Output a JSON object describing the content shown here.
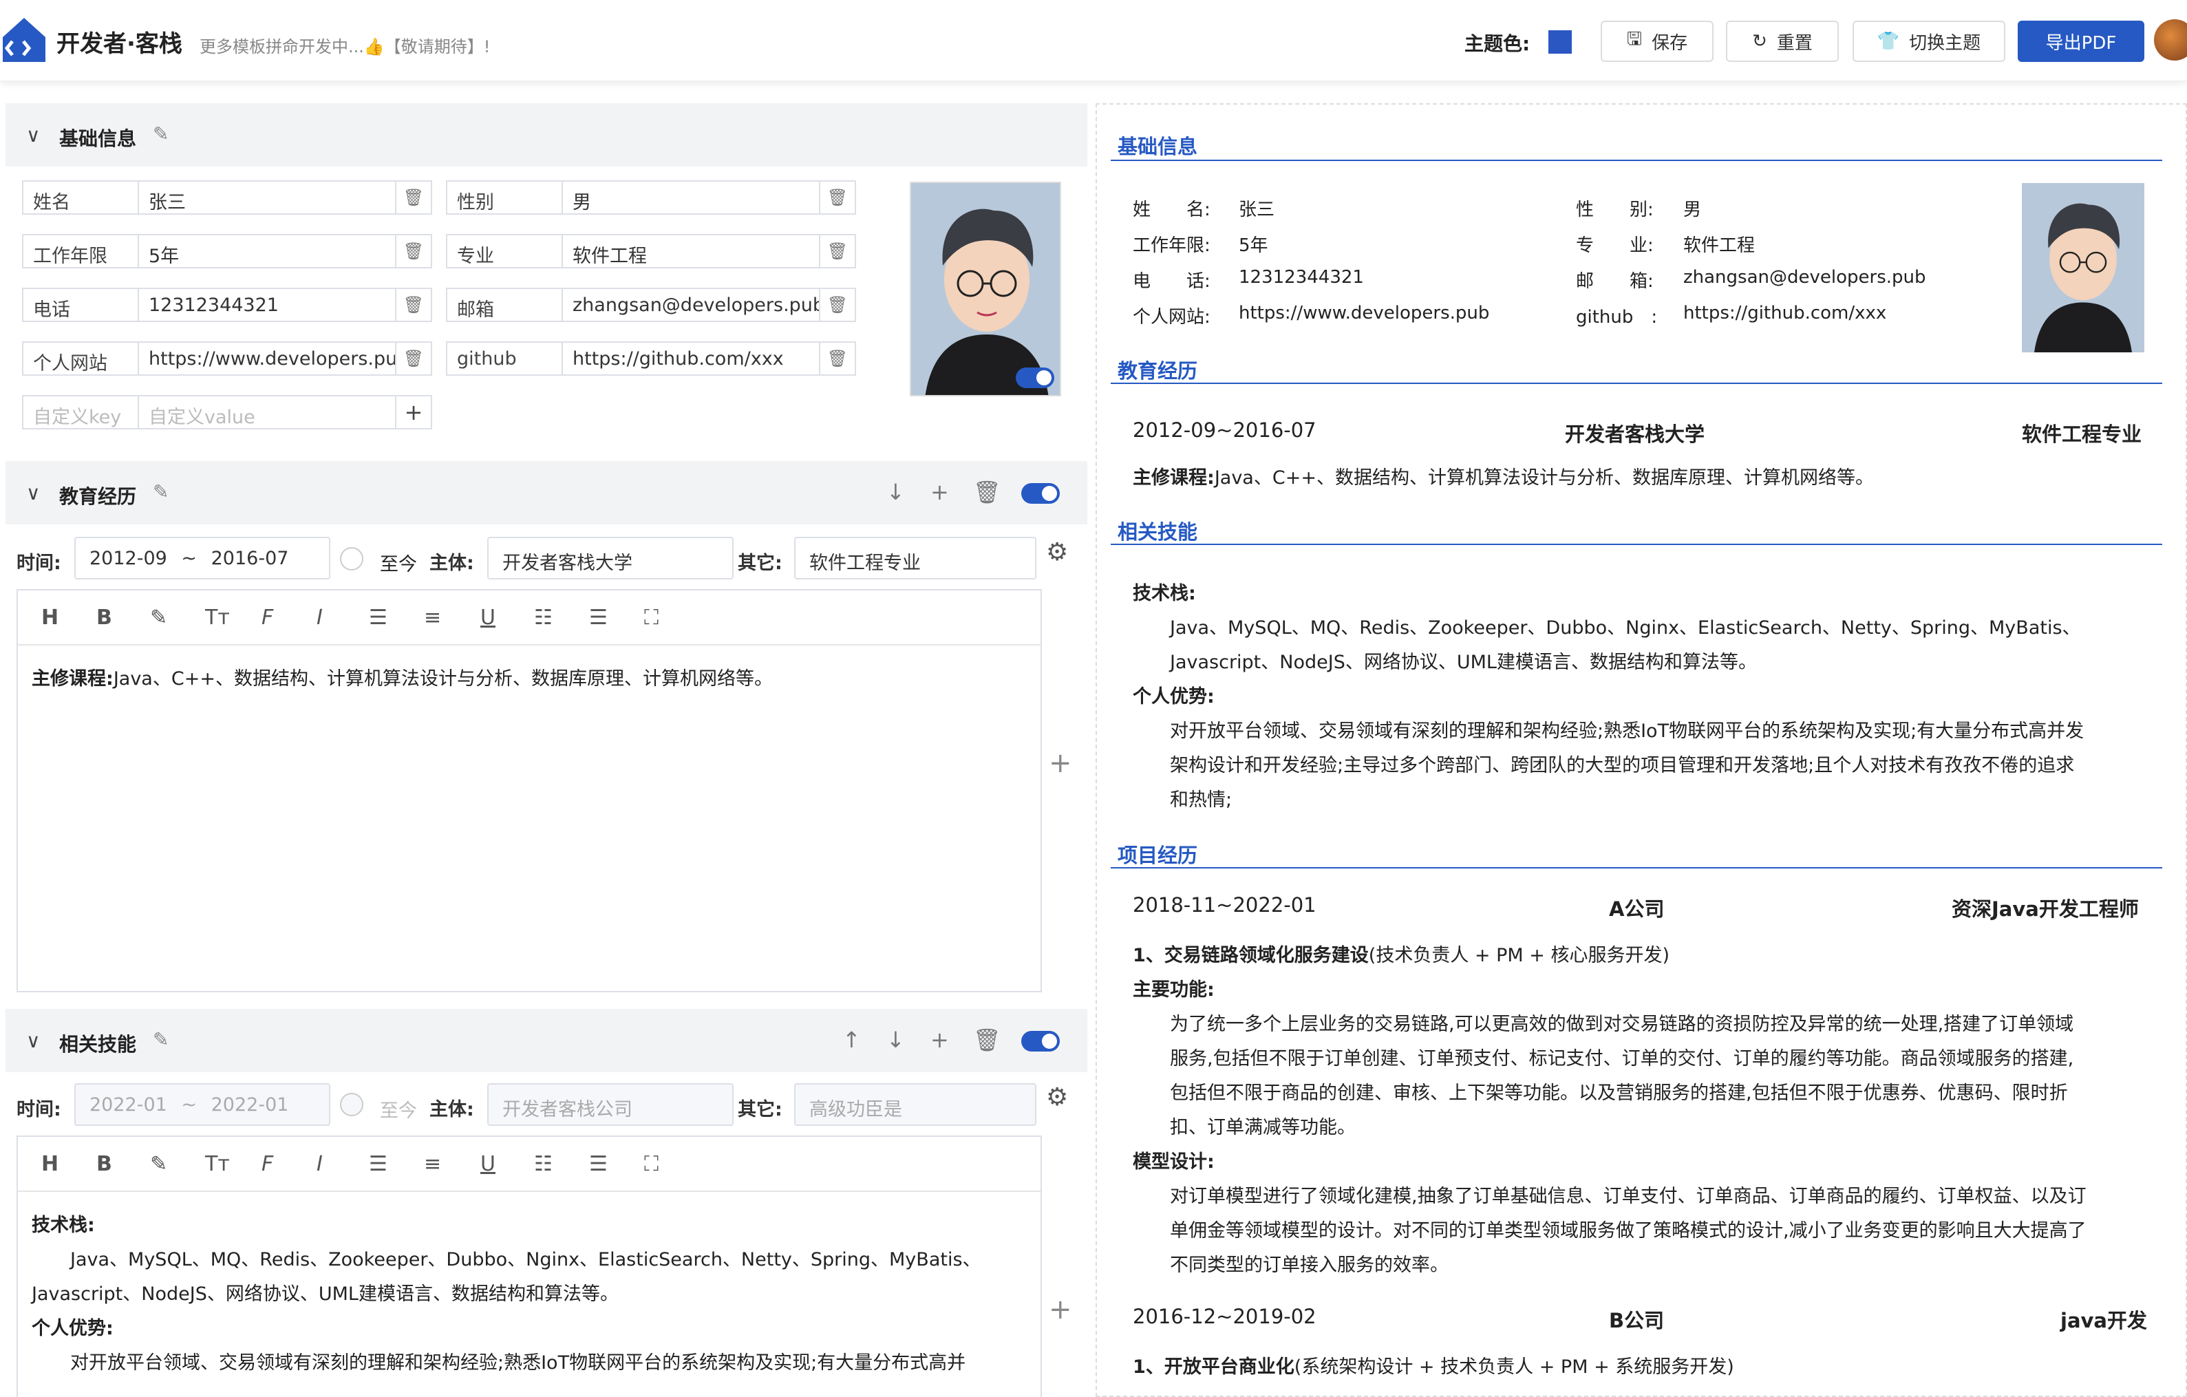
{
  "header": {
    "title": "开发者·客栈",
    "subtitle": "更多模板拼命开发中...👍【敬请期待】!",
    "theme_label": "主题色:",
    "theme_color": "#2b57c2",
    "buttons": {
      "save": "保存",
      "reset": "重置",
      "switch_theme": "切换主题",
      "export": "导出PDF"
    }
  },
  "basic": {
    "title": "基础信息",
    "fields_left": [
      {
        "key": "姓名",
        "value": "张三"
      },
      {
        "key": "工作年限",
        "value": "5年"
      },
      {
        "key": "电话",
        "value": "12312344321"
      },
      {
        "key": "个人网站",
        "value": "https://www.developers.pub"
      }
    ],
    "fields_right": [
      {
        "key": "性别",
        "value": "男"
      },
      {
        "key": "专业",
        "value": "软件工程"
      },
      {
        "key": "邮箱",
        "value": "zhangsan@developers.pub"
      },
      {
        "key": "github",
        "value": "https://github.com/xxx"
      }
    ],
    "custom_key_placeholder": "自定义key",
    "custom_value_placeholder": "自定义value"
  },
  "education": {
    "title": "教育经历",
    "time_label": "时间:",
    "start": "2012-09",
    "sep": "~",
    "end": "2016-07",
    "present_label": "至今",
    "subject_label": "主体:",
    "subject": "开发者客栈大学",
    "other_label": "其它:",
    "other": "软件工程专业",
    "content_label": "主修课程:",
    "content": "Java、C++、数据结构、计算机算法设计与分析、数据库原理、计算机网络等。"
  },
  "skills": {
    "title": "相关技能",
    "time_label": "时间:",
    "start_ph": "2022-01",
    "sep": "~",
    "end_ph": "2022-01",
    "present_label": "至今",
    "subject_label": "主体:",
    "subject_ph": "开发者客栈公司",
    "other_label": "其它:",
    "other_ph": "高级功臣是",
    "stack_label": "技术栈:",
    "stack_line1": "Java、MySQL、MQ、Redis、Zookeeper、Dubbo、Nginx、ElasticSearch、Netty、Spring、MyBatis、",
    "stack_line2": "Javascript、NodeJS、网络协议、UML建模语言、数据结构和算法等。",
    "adv_label": "个人优势:",
    "adv_line1": "对开放平台领域、交易领域有深刻的理解和架构经验;熟悉IoT物联网平台的系统架构及实现;有大量分布式高并"
  },
  "preview": {
    "basic_title": "基础信息",
    "basic_rows": [
      {
        "k": "姓　　名:",
        "v": "张三",
        "k2": "性　　别:",
        "v2": "男"
      },
      {
        "k": "工作年限:",
        "v": "5年",
        "k2": "专　　业:",
        "v2": "软件工程"
      },
      {
        "k": "电　　话:",
        "v": "12312344321",
        "k2": "邮　　箱:",
        "v2": "zhangsan@developers.pub"
      },
      {
        "k": "个人网站:",
        "v": "https://www.developers.pub",
        "k2": "github　:",
        "v2": "https://github.com/xxx"
      }
    ],
    "edu_title": "教育经历",
    "edu_time": "2012-09~2016-07",
    "edu_school": "开发者客栈大学",
    "edu_major": "软件工程专业",
    "edu_course_label": "主修课程:",
    "edu_course": "Java、C++、数据结构、计算机算法设计与分析、数据库原理、计算机网络等。",
    "skill_title": "相关技能",
    "skill_stack_label": "技术栈:",
    "skill_stack1": "Java、MySQL、MQ、Redis、Zookeeper、Dubbo、Nginx、ElasticSearch、Netty、Spring、MyBatis、",
    "skill_stack2": "Javascript、NodeJS、网络协议、UML建模语言、数据结构和算法等。",
    "skill_adv_label": "个人优势:",
    "skill_adv1": "对开放平台领域、交易领域有深刻的理解和架构经验;熟悉IoT物联网平台的系统架构及实现;有大量分布式高并发",
    "skill_adv2": "架构设计和开发经验;主导过多个跨部门、跨团队的大型的项目管理和开发落地;且个人对技术有孜孜不倦的追求",
    "skill_adv3": "和热情;",
    "proj_title": "项目经历",
    "proj1_time": "2018-11~2022-01",
    "proj1_company": "A公司",
    "proj1_role": "资深Java开发工程师",
    "proj1_name": "1、交易链路领域化服务建设",
    "proj1_name_detail": "(技术负责人 + PM + 核心服务开发)",
    "proj1_func_label": "主要功能:",
    "proj1_func1": "为了统一多个上层业务的交易链路,可以更高效的做到对交易链路的资损防控及异常的统一处理,搭建了订单领域",
    "proj1_func2": "服务,包括但不限于订单创建、订单预支付、标记支付、订单的交付、订单的履约等功能。商品领域服务的搭建,",
    "proj1_func3": "包括但不限于商品的创建、审核、上下架等功能。以及营销服务的搭建,包括但不限于优惠券、优惠码、限时折",
    "proj1_func4": "扣、订单满减等功能。",
    "proj1_model_label": "模型设计:",
    "proj1_model1": "对订单模型进行了领域化建模,抽象了订单基础信息、订单支付、订单商品、订单商品的履约、订单权益、以及订",
    "proj1_model2": "单佣金等领域模型的设计。对不同的订单类型领域服务做了策略模式的设计,减小了业务变更的影响且大大提高了",
    "proj1_model3": "不同类型的订单接入服务的效率。",
    "proj2_time": "2016-12~2019-02",
    "proj2_company": "B公司",
    "proj2_role": "java开发",
    "proj2_name": "1、开放平台商业化",
    "proj2_name_detail": "(系统架构设计 + 技术负责人 + PM + 系统服务开发)"
  }
}
